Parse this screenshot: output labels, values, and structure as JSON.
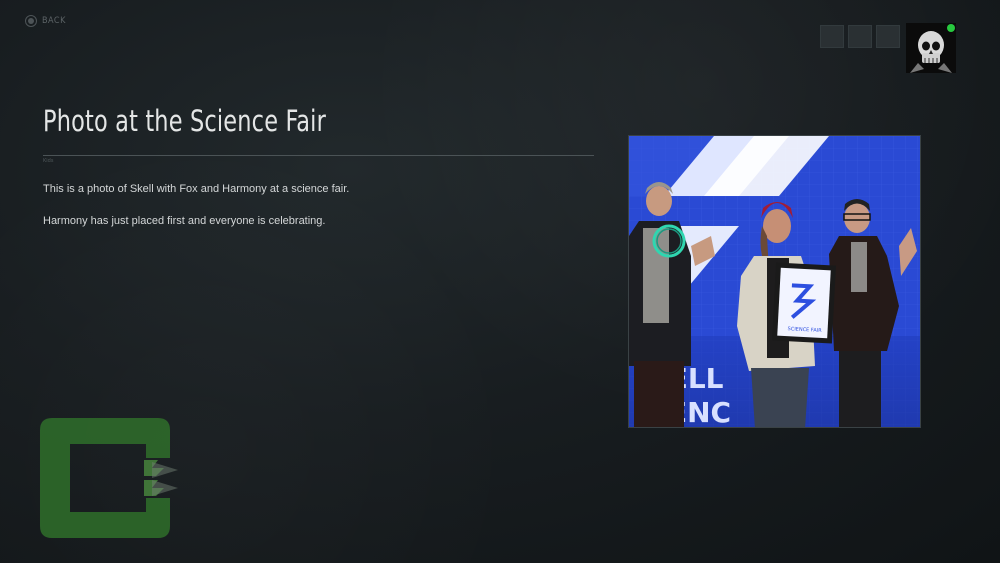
{
  "nav": {
    "back_label": "BACK"
  },
  "item": {
    "title": "Photo at the Science Fair",
    "category": "Kids",
    "description": [
      "This is a photo of Skell with Fox and Harmony at a science fair.",
      "Harmony has just placed first and everyone is celebrating."
    ],
    "photo_text_1": "KELL",
    "photo_text_2": "CIENC",
    "award_text": "SCIENCE FAIR"
  },
  "colors": {
    "status_online": "#27c93f",
    "logo_green": "#2f6e2a",
    "photo_blue": "#2240c4",
    "text_primary": "#e4e6e6"
  },
  "icons": {
    "back": "controller-b-button-icon",
    "avatar": "skull-avatar-icon",
    "logo": "studio-c-logo-icon"
  }
}
